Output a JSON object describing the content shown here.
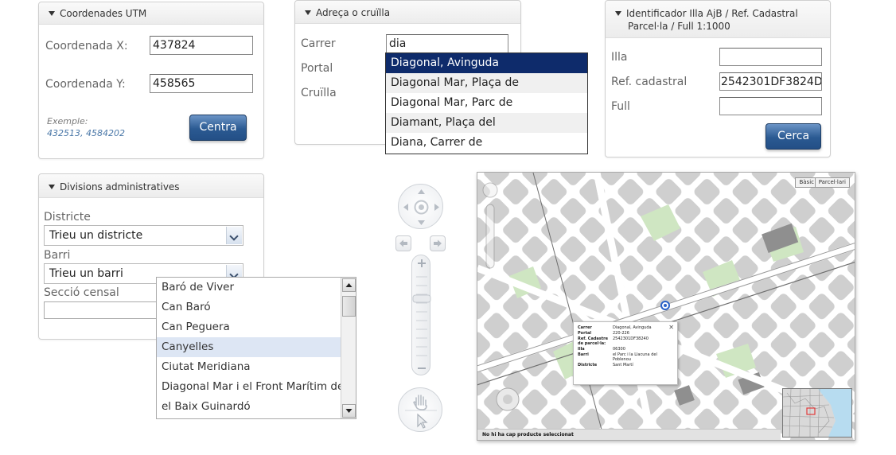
{
  "utm": {
    "title": "Coordenades UTM",
    "x_label": "Coordenada X:",
    "x_value": "437824",
    "y_label": "Coordenada Y:",
    "y_value": "458565",
    "example_label": "Exemple:",
    "example_value": "432513, 4584202",
    "button": "Centra"
  },
  "address": {
    "title": "Adreça o cruïlla",
    "street_label": "Carrer",
    "street_value": "dia",
    "portal_label": "Portal",
    "crossing_label": "Cruïlla",
    "suggestions": [
      "Diagonal, Avinguda",
      "Diagonal Mar, Plaça de",
      "Diagonal Mar, Parc de",
      "Diamant, Plaça del",
      "Diana, Carrer de"
    ]
  },
  "cadastre": {
    "title_line1": "Identificador Illa AjB / Ref. Cadastral",
    "title_line2": "Parcel·la / Full 1:1000",
    "illa_label": "Illa",
    "ref_label": "Ref. cadastral",
    "ref_value": "2542301DF3824D",
    "full_label": "Full",
    "button": "Cerca"
  },
  "divisions": {
    "title": "Divisions administratives",
    "district_label": "Districte",
    "district_value": "Trieu un districte",
    "barri_label": "Barri",
    "barri_value": "Trieu un barri",
    "seccio_label": "Secció censal",
    "barri_options": [
      "Baró de Viver",
      "Can Baró",
      "Can Peguera",
      "Canyelles",
      "Ciutat Meridiana",
      "Diagonal Mar i el Front Marítim del Poblenou",
      "el Baix Guinardó"
    ]
  },
  "map": {
    "layer_buttons": [
      "Bàsic",
      "Parcel·lari"
    ],
    "status": "No hi ha cap producte seleccionat",
    "popup": {
      "rows": [
        {
          "key": "Carrer",
          "value": "Diagonal, Avinguda"
        },
        {
          "key": "Portal",
          "value": "220-226"
        },
        {
          "key": "Ref. Cadastre de parcel·la:",
          "value": "2542301DF38240"
        },
        {
          "key": "Illa",
          "value": "06300"
        },
        {
          "key": "Barri",
          "value": "el Parc i la Llacuna del Poblenou"
        },
        {
          "key": "Districte",
          "value": "Sant Martí"
        }
      ]
    }
  },
  "icons": {
    "pan": "pan-icon",
    "zoom_in": "plus-icon",
    "zoom_out": "minus-icon",
    "hand": "hand-icon",
    "pointer": "cursor-icon"
  },
  "colors": {
    "accent_button": "#2b5a92",
    "selection": "#0e2b6b",
    "park": "#cfe6c2",
    "water": "#b7dcf0"
  }
}
